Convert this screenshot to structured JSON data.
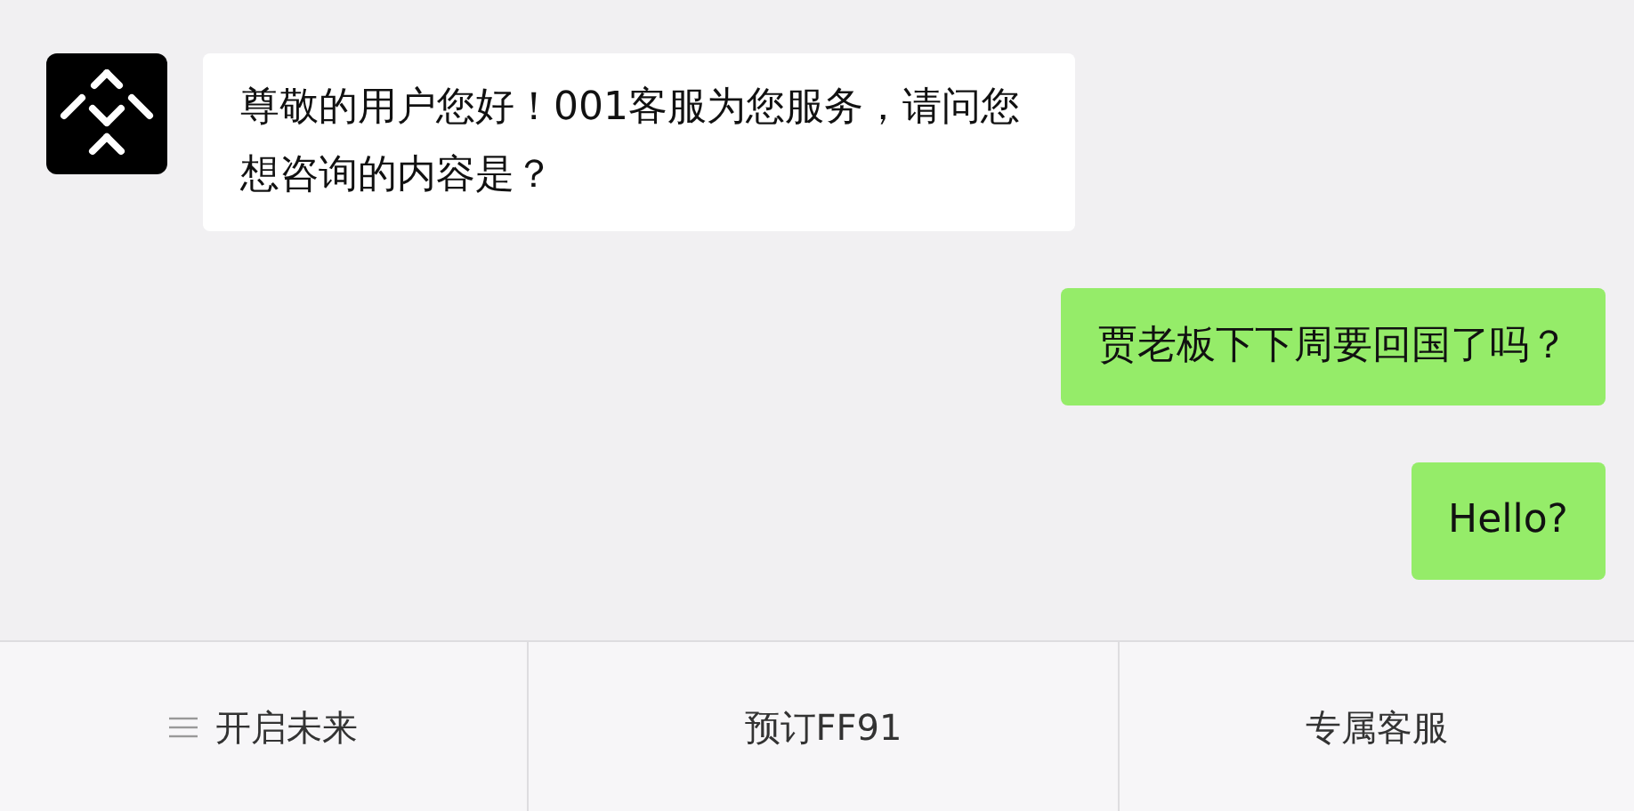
{
  "messages": [
    {
      "kind": "incoming",
      "text": "尊敬的用户您好！001客服为您服务，请问您想咨询的内容是？"
    },
    {
      "kind": "outgoing",
      "text": "贾老板下下周要回国了吗？"
    },
    {
      "kind": "outgoing",
      "text": "Hello?"
    }
  ],
  "menu": [
    {
      "label": "开启未来",
      "has_menu_icon": true
    },
    {
      "label": "预订FF91",
      "has_menu_icon": false
    },
    {
      "label": "专属客服",
      "has_menu_icon": false
    }
  ]
}
